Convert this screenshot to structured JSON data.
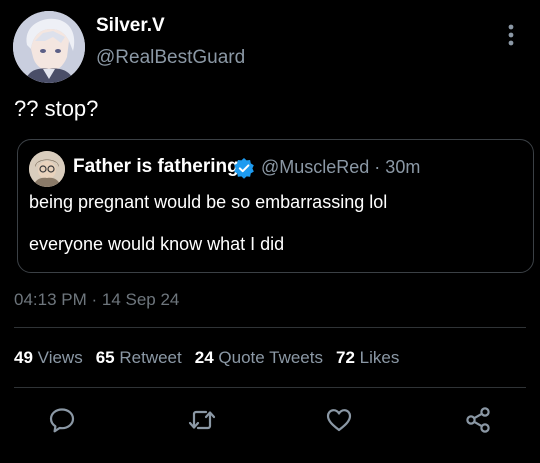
{
  "tweet": {
    "author": {
      "name": "Silver.V",
      "handle": "@RealBestGuard"
    },
    "text": "?? stop?",
    "timestamp": "04:13 PM · 14 Sep 24"
  },
  "quoted": {
    "name": "Father is fathering",
    "handle_time": "@MuscleRed · 30m",
    "verified": true,
    "line1": "being pregnant would be so embarrassing lol",
    "line2": "everyone would know what I did"
  },
  "stats": {
    "views_count": "49",
    "views_label": "Views",
    "retweets_count": "65",
    "retweets_label": "Retweet",
    "quotes_count": "24",
    "quotes_label": "Quote Tweets",
    "likes_count": "72",
    "likes_label": "Likes"
  },
  "actions": {
    "reply_icon": "reply-icon",
    "retweet_icon": "retweet-icon",
    "like_icon": "heart-icon",
    "share_icon": "share-icon"
  },
  "colors": {
    "background": "#000000",
    "text": "#ffffff",
    "secondary": "#8b98a5",
    "divider": "#2f3336",
    "verified": "#1d9bf0"
  }
}
